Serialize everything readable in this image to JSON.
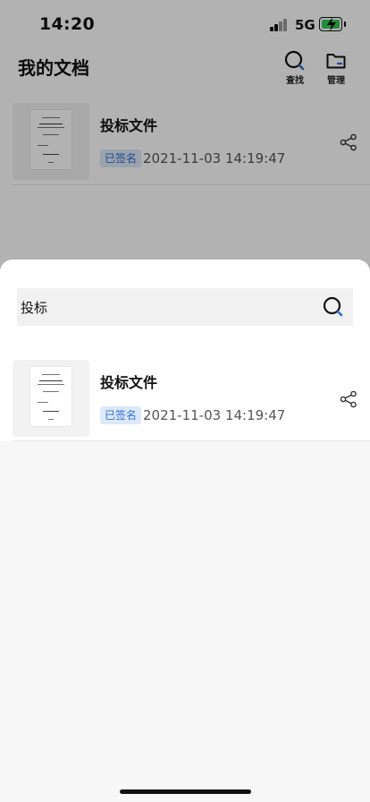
{
  "status_bar": {
    "time": "14:20",
    "network": "5G",
    "battery_color": "#34c759"
  },
  "header": {
    "title": "我的文档",
    "actions": [
      {
        "icon": "search-icon",
        "label": "查找"
      },
      {
        "icon": "folder-icon",
        "label": "管理"
      }
    ]
  },
  "documents": [
    {
      "title": "投标文件",
      "status": "已签名",
      "timestamp": "2021-11-03 14:19:47"
    }
  ],
  "search_sheet": {
    "query": "投标",
    "results": [
      {
        "title": "投标文件",
        "status": "已签名",
        "timestamp": "2021-11-03 14:19:47"
      }
    ]
  },
  "colors": {
    "accent": "#2f6fd6",
    "badge_bg": "#dde8f8",
    "overlay": "rgba(0,0,0,0.3)"
  }
}
